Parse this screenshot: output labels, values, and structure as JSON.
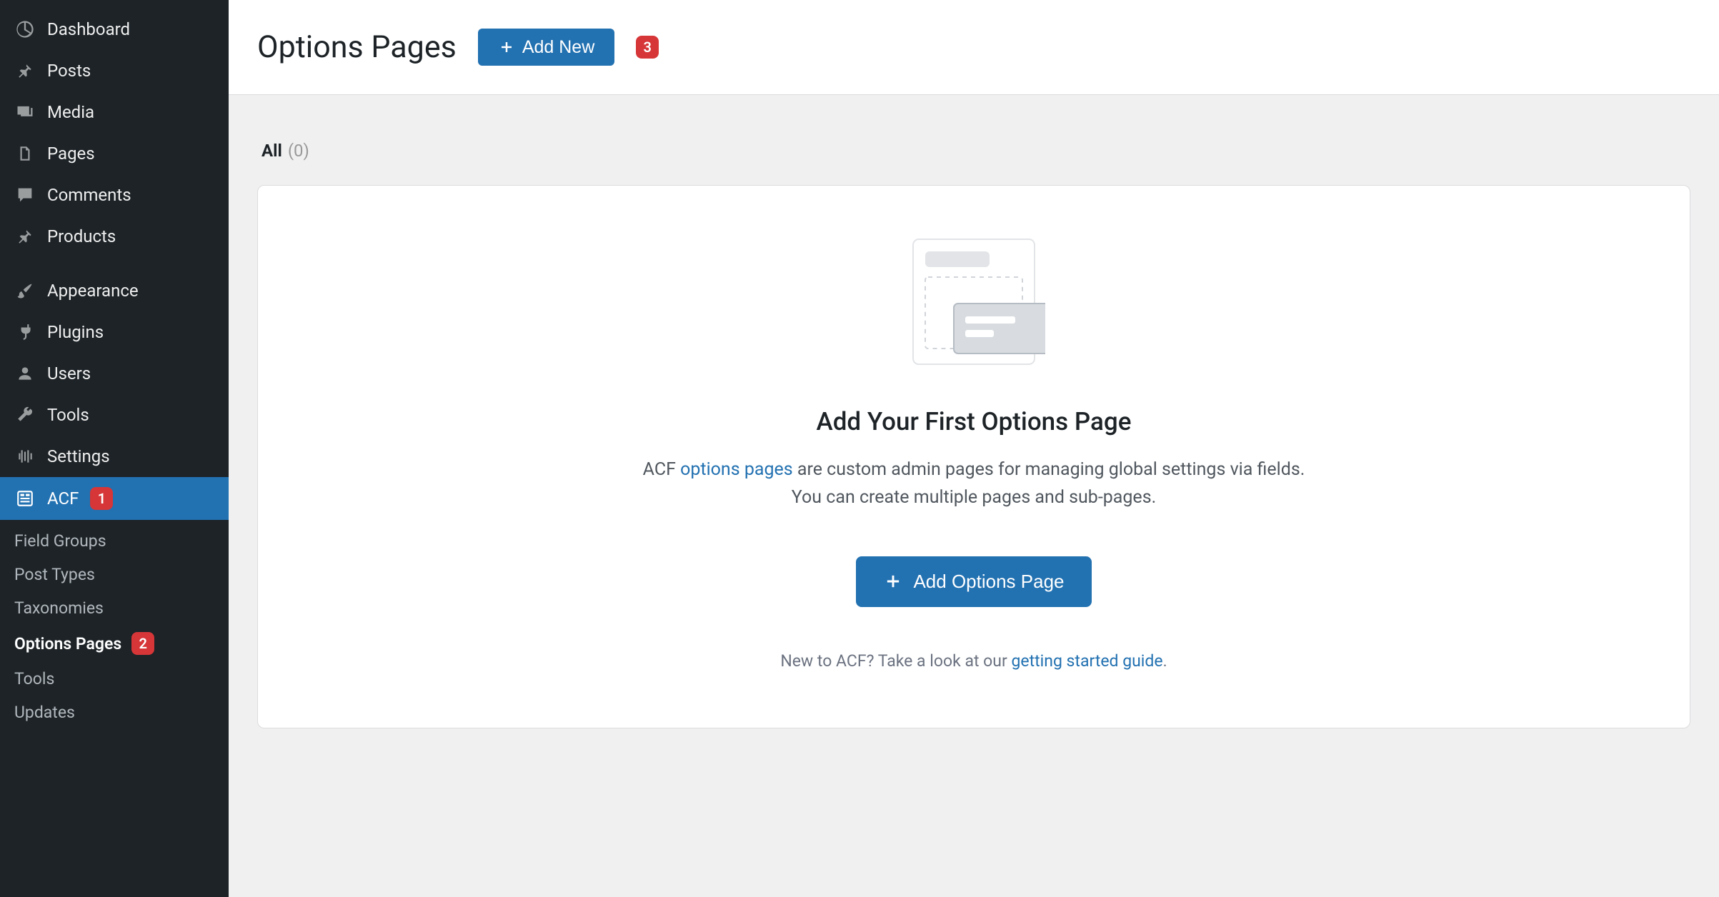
{
  "sidebar": {
    "items": [
      {
        "label": "Dashboard",
        "icon": "dashboard"
      },
      {
        "label": "Posts",
        "icon": "pin"
      },
      {
        "label": "Media",
        "icon": "media"
      },
      {
        "label": "Pages",
        "icon": "page"
      },
      {
        "label": "Comments",
        "icon": "comment"
      },
      {
        "label": "Products",
        "icon": "pin"
      },
      {
        "label": "Appearance",
        "icon": "brush"
      },
      {
        "label": "Plugins",
        "icon": "plug"
      },
      {
        "label": "Users",
        "icon": "user"
      },
      {
        "label": "Tools",
        "icon": "wrench"
      },
      {
        "label": "Settings",
        "icon": "settings"
      },
      {
        "label": "ACF",
        "icon": "acf",
        "badge": "1"
      }
    ],
    "submenu": [
      {
        "label": "Field Groups"
      },
      {
        "label": "Post Types"
      },
      {
        "label": "Taxonomies"
      },
      {
        "label": "Options Pages",
        "badge": "2",
        "current": true
      },
      {
        "label": "Tools"
      },
      {
        "label": "Updates"
      }
    ]
  },
  "header": {
    "page_title": "Options Pages",
    "add_button": "Add New",
    "header_badge": "3"
  },
  "filter": {
    "all_label": "All",
    "all_count": "(0)"
  },
  "empty": {
    "title": "Add Your First Options Page",
    "desc_before": "ACF ",
    "desc_link": "options pages",
    "desc_after": " are custom admin pages for managing global settings via fields. You can create multiple pages and sub-pages.",
    "button": "Add Options Page",
    "footer_before": "New to ACF? Take a look at our ",
    "footer_link": "getting started guide",
    "footer_after": "."
  }
}
